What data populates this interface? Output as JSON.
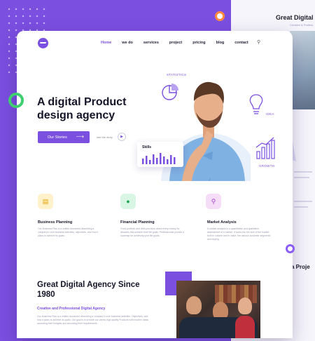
{
  "nav": {
    "items": [
      {
        "label": "Home",
        "active": true
      },
      {
        "label": "we do"
      },
      {
        "label": "services"
      },
      {
        "label": "project"
      },
      {
        "label": "pricing"
      },
      {
        "label": "blog"
      },
      {
        "label": "contact"
      }
    ]
  },
  "hero": {
    "title": "A digital Product design agency",
    "cta_label": "Our Stories",
    "secondary_label": "see the story",
    "stat_statistics": "STATISTICS",
    "stat_idea": "IDEA",
    "stat_growth": "GROWTH",
    "skills_title": "Skills"
  },
  "features": [
    {
      "title": "Business Planning",
      "icon": "chart-icon",
      "text": "Our Business Plan is a written document describing a company's core business activities, objectives, and how it plans to achieve its goals."
    },
    {
      "title": "Financial Planning",
      "icon": "money-hand-icon",
      "text": "Good portfolio and debt provision about every money for decades that achieve their life goals. Professionals provide a roadmap for achieving your life goals."
    },
    {
      "title": "Market Analysis",
      "icon": "magnifier-icon",
      "text": "A market analysis is a quantitative and qualitative assessment of a market. It looks into the size of the market both in volume and in value, the various customer segments and buying."
    }
  ],
  "about": {
    "title": "Great Digital Agency Since 1980",
    "subtitle": "Creative and Professional Digital Agency",
    "text": "Our Business Plan is a written document describing a company's core business activities. Objectives, and how it plans to achieve its goals. Our goal is to provide our clients high quality Products with modern ideas according their budgets and according their requirements."
  },
  "back_page": {
    "title": "Great Digital A",
    "subtitle": "Creative & Profess",
    "heading": "a Proje"
  },
  "colors": {
    "accent": "#7b4fe0",
    "green_ring": "#3ecf6e",
    "orange_ring": "#ff8a3d"
  }
}
